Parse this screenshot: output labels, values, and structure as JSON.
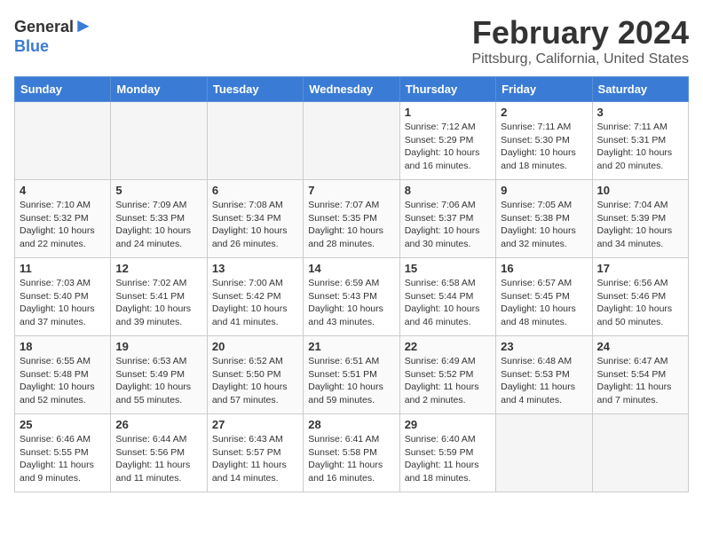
{
  "logo": {
    "general": "General",
    "blue": "Blue"
  },
  "title": "February 2024",
  "location": "Pittsburg, California, United States",
  "headers": [
    "Sunday",
    "Monday",
    "Tuesday",
    "Wednesday",
    "Thursday",
    "Friday",
    "Saturday"
  ],
  "weeks": [
    [
      {
        "day": "",
        "info": ""
      },
      {
        "day": "",
        "info": ""
      },
      {
        "day": "",
        "info": ""
      },
      {
        "day": "",
        "info": ""
      },
      {
        "day": "1",
        "info": "Sunrise: 7:12 AM\nSunset: 5:29 PM\nDaylight: 10 hours\nand 16 minutes."
      },
      {
        "day": "2",
        "info": "Sunrise: 7:11 AM\nSunset: 5:30 PM\nDaylight: 10 hours\nand 18 minutes."
      },
      {
        "day": "3",
        "info": "Sunrise: 7:11 AM\nSunset: 5:31 PM\nDaylight: 10 hours\nand 20 minutes."
      }
    ],
    [
      {
        "day": "4",
        "info": "Sunrise: 7:10 AM\nSunset: 5:32 PM\nDaylight: 10 hours\nand 22 minutes."
      },
      {
        "day": "5",
        "info": "Sunrise: 7:09 AM\nSunset: 5:33 PM\nDaylight: 10 hours\nand 24 minutes."
      },
      {
        "day": "6",
        "info": "Sunrise: 7:08 AM\nSunset: 5:34 PM\nDaylight: 10 hours\nand 26 minutes."
      },
      {
        "day": "7",
        "info": "Sunrise: 7:07 AM\nSunset: 5:35 PM\nDaylight: 10 hours\nand 28 minutes."
      },
      {
        "day": "8",
        "info": "Sunrise: 7:06 AM\nSunset: 5:37 PM\nDaylight: 10 hours\nand 30 minutes."
      },
      {
        "day": "9",
        "info": "Sunrise: 7:05 AM\nSunset: 5:38 PM\nDaylight: 10 hours\nand 32 minutes."
      },
      {
        "day": "10",
        "info": "Sunrise: 7:04 AM\nSunset: 5:39 PM\nDaylight: 10 hours\nand 34 minutes."
      }
    ],
    [
      {
        "day": "11",
        "info": "Sunrise: 7:03 AM\nSunset: 5:40 PM\nDaylight: 10 hours\nand 37 minutes."
      },
      {
        "day": "12",
        "info": "Sunrise: 7:02 AM\nSunset: 5:41 PM\nDaylight: 10 hours\nand 39 minutes."
      },
      {
        "day": "13",
        "info": "Sunrise: 7:00 AM\nSunset: 5:42 PM\nDaylight: 10 hours\nand 41 minutes."
      },
      {
        "day": "14",
        "info": "Sunrise: 6:59 AM\nSunset: 5:43 PM\nDaylight: 10 hours\nand 43 minutes."
      },
      {
        "day": "15",
        "info": "Sunrise: 6:58 AM\nSunset: 5:44 PM\nDaylight: 10 hours\nand 46 minutes."
      },
      {
        "day": "16",
        "info": "Sunrise: 6:57 AM\nSunset: 5:45 PM\nDaylight: 10 hours\nand 48 minutes."
      },
      {
        "day": "17",
        "info": "Sunrise: 6:56 AM\nSunset: 5:46 PM\nDaylight: 10 hours\nand 50 minutes."
      }
    ],
    [
      {
        "day": "18",
        "info": "Sunrise: 6:55 AM\nSunset: 5:48 PM\nDaylight: 10 hours\nand 52 minutes."
      },
      {
        "day": "19",
        "info": "Sunrise: 6:53 AM\nSunset: 5:49 PM\nDaylight: 10 hours\nand 55 minutes."
      },
      {
        "day": "20",
        "info": "Sunrise: 6:52 AM\nSunset: 5:50 PM\nDaylight: 10 hours\nand 57 minutes."
      },
      {
        "day": "21",
        "info": "Sunrise: 6:51 AM\nSunset: 5:51 PM\nDaylight: 10 hours\nand 59 minutes."
      },
      {
        "day": "22",
        "info": "Sunrise: 6:49 AM\nSunset: 5:52 PM\nDaylight: 11 hours\nand 2 minutes."
      },
      {
        "day": "23",
        "info": "Sunrise: 6:48 AM\nSunset: 5:53 PM\nDaylight: 11 hours\nand 4 minutes."
      },
      {
        "day": "24",
        "info": "Sunrise: 6:47 AM\nSunset: 5:54 PM\nDaylight: 11 hours\nand 7 minutes."
      }
    ],
    [
      {
        "day": "25",
        "info": "Sunrise: 6:46 AM\nSunset: 5:55 PM\nDaylight: 11 hours\nand 9 minutes."
      },
      {
        "day": "26",
        "info": "Sunrise: 6:44 AM\nSunset: 5:56 PM\nDaylight: 11 hours\nand 11 minutes."
      },
      {
        "day": "27",
        "info": "Sunrise: 6:43 AM\nSunset: 5:57 PM\nDaylight: 11 hours\nand 14 minutes."
      },
      {
        "day": "28",
        "info": "Sunrise: 6:41 AM\nSunset: 5:58 PM\nDaylight: 11 hours\nand 16 minutes."
      },
      {
        "day": "29",
        "info": "Sunrise: 6:40 AM\nSunset: 5:59 PM\nDaylight: 11 hours\nand 18 minutes."
      },
      {
        "day": "",
        "info": ""
      },
      {
        "day": "",
        "info": ""
      }
    ]
  ]
}
